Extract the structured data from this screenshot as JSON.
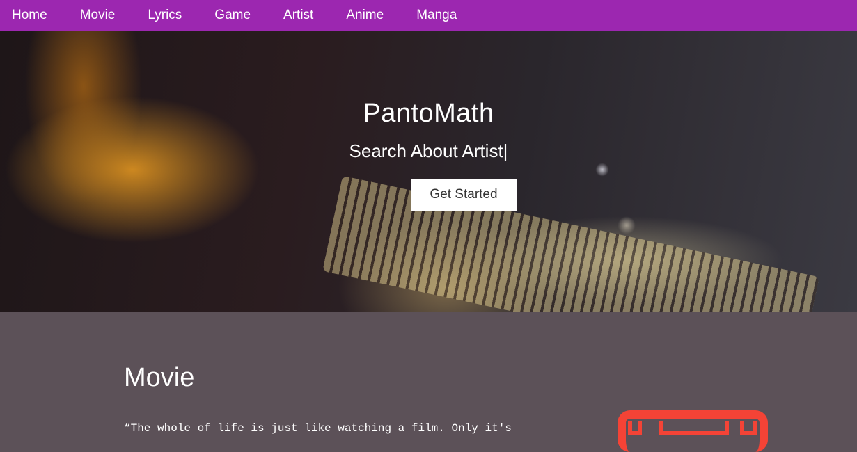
{
  "nav": {
    "items": [
      "Home",
      "Movie",
      "Lyrics",
      "Game",
      "Artist",
      "Anime",
      "Manga"
    ]
  },
  "hero": {
    "title": "PantoMath",
    "subtitle": "Search About Artist|",
    "button_label": "Get Started"
  },
  "section": {
    "title": "Movie",
    "quote": "“The whole of life is just like watching a film. Only it's"
  },
  "colors": {
    "nav_bg": "#9c27b0",
    "section_bg": "#5c5158",
    "icon_red": "#f44336"
  },
  "icons": {
    "film": "film-icon"
  }
}
